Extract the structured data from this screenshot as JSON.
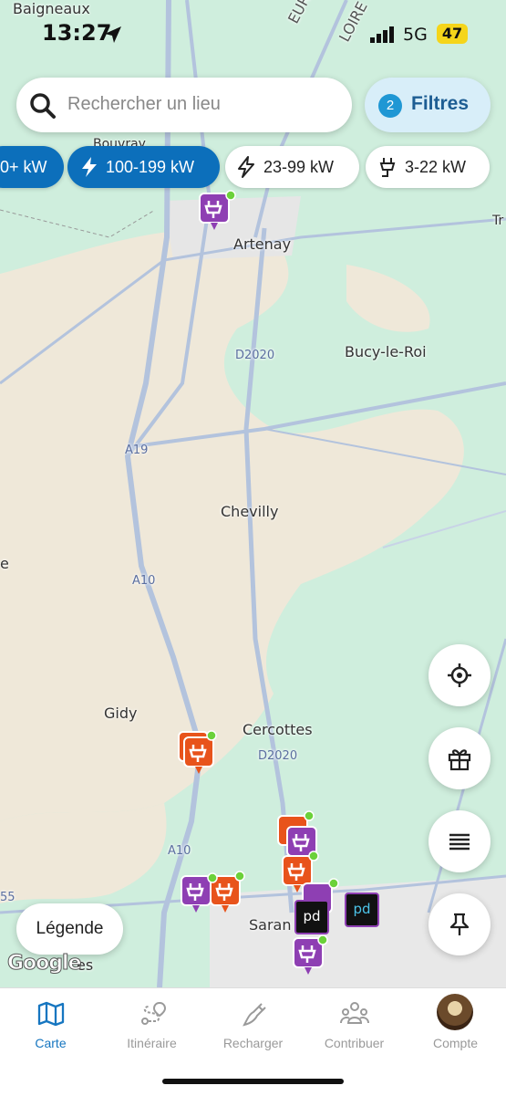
{
  "status_bar": {
    "time": "13:27",
    "network": "5G",
    "battery": "47"
  },
  "search": {
    "placeholder": "Rechercher un lieu"
  },
  "filters": {
    "count": "2",
    "label": "Filtres"
  },
  "power_chips": [
    {
      "label": "0+ kW",
      "active": true
    },
    {
      "label": "100-199 kW",
      "active": true
    },
    {
      "label": "23-99 kW",
      "active": false
    },
    {
      "label": "3-22 kW",
      "active": false
    }
  ],
  "map": {
    "places": [
      "Baigneaux",
      "Artenay",
      "Bucy-le-Roi",
      "Chevilly",
      "Gidy",
      "Cercottes",
      "Saran",
      "Bouvray",
      "es",
      "e",
      "55",
      "Tr"
    ],
    "roads": [
      "EURE-E",
      "LOIRE",
      "D2020",
      "A19",
      "A10",
      "D2020",
      "A10"
    ],
    "marker_text": [
      "pd",
      "pd"
    ]
  },
  "legend_label": "Légende",
  "attribution": "Google",
  "side_buttons": [
    "locate-icon",
    "gift-icon",
    "list-icon",
    "pin-icon"
  ],
  "tabs": [
    {
      "label": "Carte",
      "icon": "map-icon",
      "active": true
    },
    {
      "label": "Itinéraire",
      "icon": "route-icon",
      "active": false
    },
    {
      "label": "Recharger",
      "icon": "charge-icon",
      "active": false
    },
    {
      "label": "Contribuer",
      "icon": "community-icon",
      "active": false
    },
    {
      "label": "Compte",
      "icon": "avatar-icon",
      "active": false
    }
  ],
  "colors": {
    "accent": "#0c6fbb",
    "marker_purple": "#8e3fb3",
    "marker_orange": "#e8531b",
    "map_green": "#cfeedd",
    "map_beige": "#efe8d9"
  }
}
